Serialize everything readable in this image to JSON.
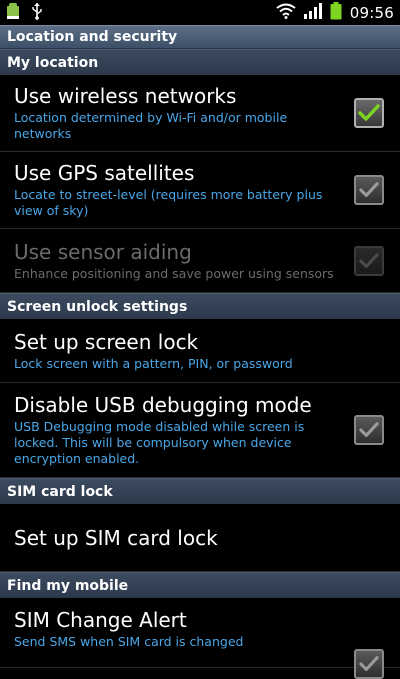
{
  "status_bar": {
    "time": "09:56",
    "icons": [
      "android-notification-icon",
      "usb-icon",
      "wifi-icon",
      "signal-icon",
      "battery-icon"
    ]
  },
  "title": "Location and security",
  "sections": {
    "my_location": "My location",
    "screen_unlock": "Screen unlock settings",
    "sim_lock": "SIM card lock",
    "find_mobile": "Find my mobile"
  },
  "items": {
    "wireless": {
      "title": "Use wireless networks",
      "subtitle": "Location determined by Wi-Fi and/or mobile networks",
      "checked": true
    },
    "gps": {
      "title": "Use GPS satellites",
      "subtitle": "Locate to street-level (requires more battery plus view of sky)",
      "checked": true
    },
    "sensor": {
      "title": "Use sensor aiding",
      "subtitle": "Enhance positioning and save power using sensors",
      "checked": true,
      "enabled": false
    },
    "screen_lock": {
      "title": "Set up screen lock",
      "subtitle": "Lock screen with a pattern, PIN, or password"
    },
    "usb_debug": {
      "title": "Disable USB debugging mode",
      "subtitle": "USB Debugging mode disabled while screen is locked. This will be compulsory when device encryption enabled.",
      "checked": true
    },
    "sim_lock": {
      "title": "Set up SIM card lock"
    },
    "sim_alert": {
      "title": "SIM Change Alert",
      "subtitle": "Send SMS when SIM card is changed",
      "checked": true
    }
  },
  "colors": {
    "accent_subtitle": "#4aa7e8",
    "check_green": "#7ed321",
    "check_grey": "#9a9a9a"
  }
}
